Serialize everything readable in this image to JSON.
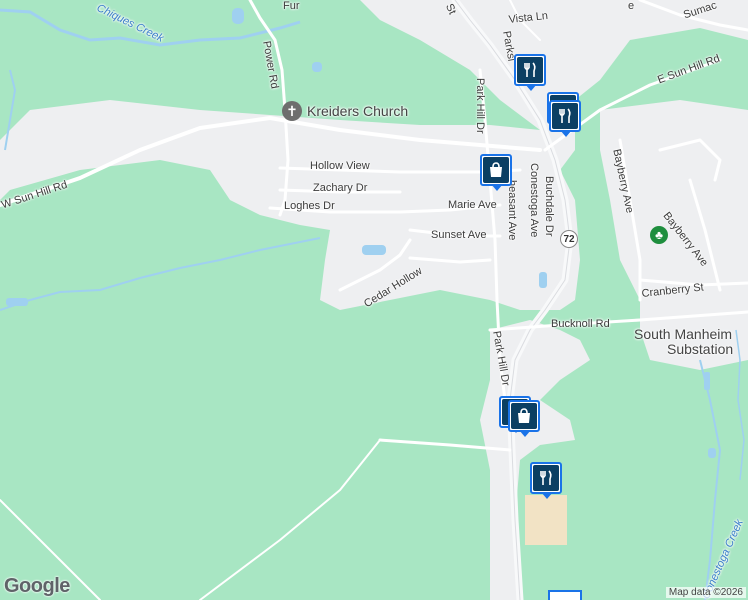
{
  "map": {
    "attribution": "Map data ©2026",
    "logo": "Google"
  },
  "labels": {
    "kreiders_church": "Kreiders Church",
    "hollow_view": "Hollow View",
    "zachary_dr": "Zachary Dr",
    "loghes_dr": "Loghes Dr",
    "marie_ave": "Marie Ave",
    "sunset_ave": "Sunset Ave",
    "cedar_hollow": "Cedar Hollow",
    "w_sun_hill_rd": "W Sun Hill Rd",
    "power_rd": "Power Rd",
    "chiques_creek": "Chiques Creek",
    "vista_ln": "Vista Ln",
    "parkside": "Parksi",
    "park_hill_dr_n": "Park Hill Dr",
    "park_hill_dr_s": "Park Hill Dr",
    "e_sun_hill_rd": "E Sun Hill Rd",
    "st": "St",
    "pheasant_ave": "heasant Ave",
    "conestoga_ave": "Conestoga Ave",
    "buchdale_dr": "Buchdale Dr",
    "bayberry_ave_w": "Bayberry Ave",
    "bayberry_ave_e": "Bayberry Ave",
    "cranberry_st": "Cranberry St",
    "bucknoll_rd": "Bucknoll Rd",
    "south_manheim_substation_1": "South Manheim",
    "south_manheim_substation_2": "Substation",
    "route_72": "72",
    "sumac": "Sumac",
    "furnace": "Fur",
    "conestoga_creek": "Conestoga Creek",
    "top_right_e": "e"
  },
  "pins": [
    {
      "id": "restaurant-pin-1",
      "icon": "fork-knife-icon"
    },
    {
      "id": "grocery-pin",
      "icon": "shopping-cart-icon"
    },
    {
      "id": "restaurant-pin-2",
      "icon": "fork-knife-icon"
    },
    {
      "id": "shopping-pin-1",
      "icon": "shopping-bag-icon"
    },
    {
      "id": "shopping-pin-2",
      "icon": "shopping-bag-icon"
    },
    {
      "id": "restaurant-pin-3",
      "icon": "fork-knife-icon"
    },
    {
      "id": "restaurant-pin-4",
      "icon": "fork-knife-icon"
    }
  ],
  "colors": {
    "park_green": "#a8e6c3",
    "urban_gray": "#eeeff1",
    "road_white": "#ffffff",
    "water_blue": "#9fd0f0",
    "pin_blue": "#1a73e8",
    "pin_dark": "#0b3f63",
    "commercial_tan": "#f2e3c5"
  }
}
